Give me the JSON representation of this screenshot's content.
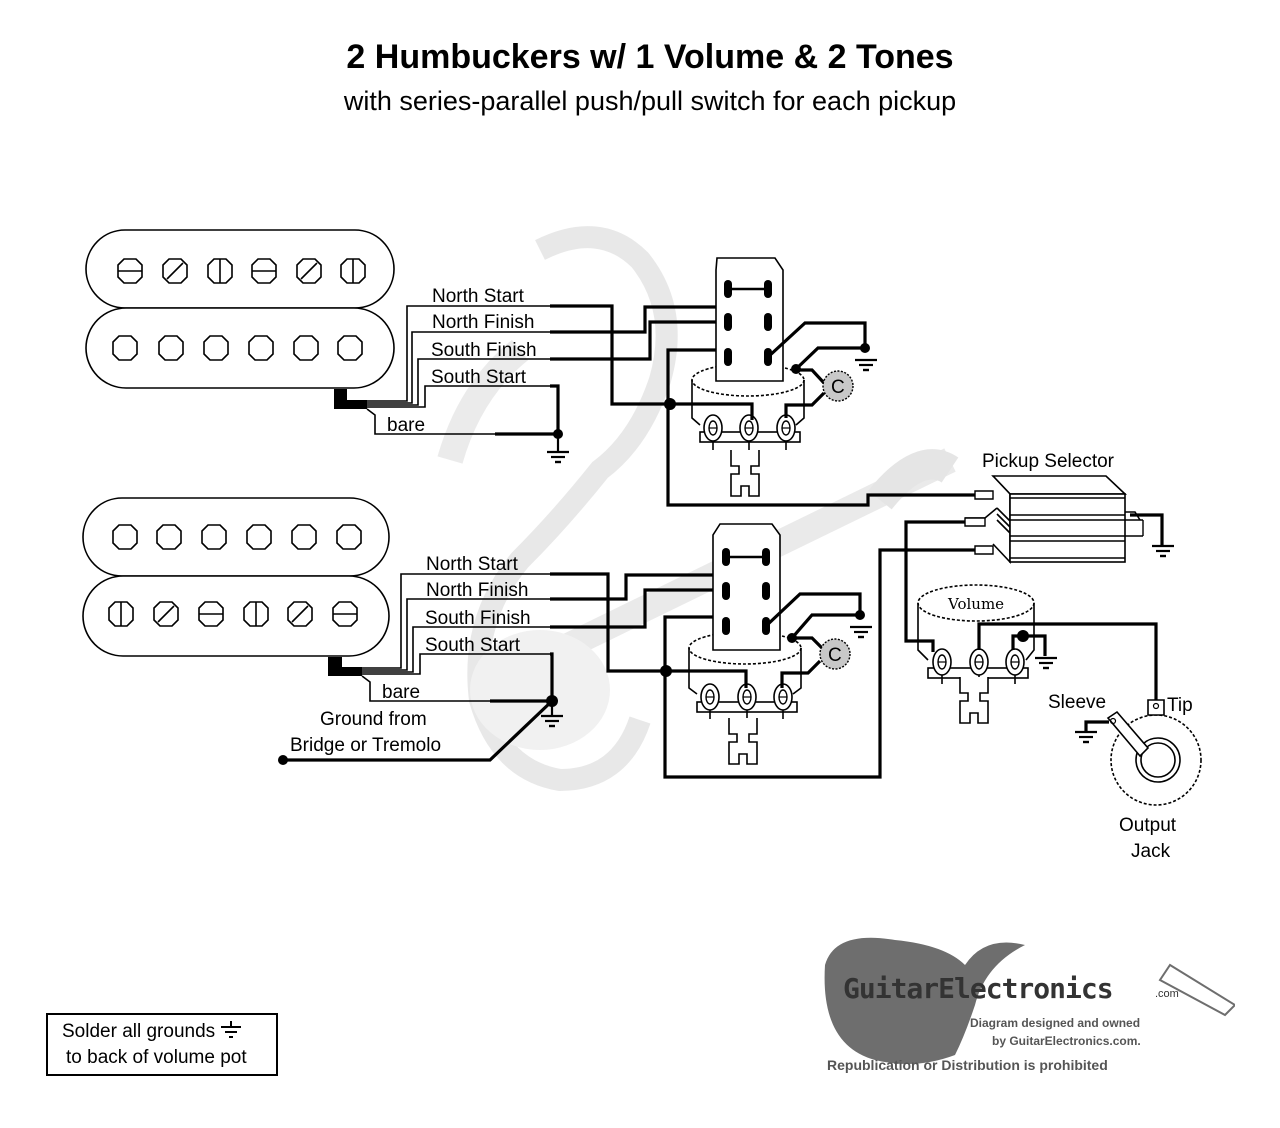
{
  "header": {
    "title": "2 Humbuckers w/ 1 Volume & 2 Tones",
    "subtitle": "with series-parallel push/pull switch for each pickup"
  },
  "pickups": [
    {
      "id": "neck",
      "wires": [
        "North Start",
        "North Finish",
        "South Finish",
        "South Start"
      ],
      "bare_label": "bare",
      "pole_screws": [
        "horizontal-slot",
        "diagonal-slot",
        "vertical-slot",
        "horizontal-slot",
        "diagonal-slot",
        "vertical-slot"
      ]
    },
    {
      "id": "bridge",
      "wires": [
        "North Start",
        "North Finish",
        "South Finish",
        "South Start"
      ],
      "bare_label": "bare",
      "pole_screws": [
        "vertical-slot",
        "diagonal-slot",
        "horizontal-slot",
        "vertical-slot",
        "diagonal-slot",
        "horizontal-slot"
      ],
      "extra_ground_label_line1": "Ground from",
      "extra_ground_label_line2": "Bridge or Tremolo"
    }
  ],
  "components": {
    "capacitor_label": "C",
    "pickup_selector_label": "Pickup Selector",
    "volume_label": "Volume",
    "jack": {
      "sleeve_label": "Sleeve",
      "tip_label": "Tip",
      "name_line1": "Output",
      "name_line2": "Jack"
    }
  },
  "note": {
    "line1": "Solder all grounds",
    "line2": "to back of volume pot",
    "icon": "ground-icon"
  },
  "footer": {
    "brand": "GuitarElectronics",
    "brand_suffix": ".com",
    "credit_line1": "Diagram designed and owned",
    "credit_line2": "by GuitarElectronics.com.",
    "notice": "Republication or Distribution is prohibited"
  },
  "colors": {
    "ink": "#000000",
    "watermark": "#d8d8d8",
    "capacitor_fill": "#c8c8c8",
    "logo_gray": "#6e6e6e"
  }
}
